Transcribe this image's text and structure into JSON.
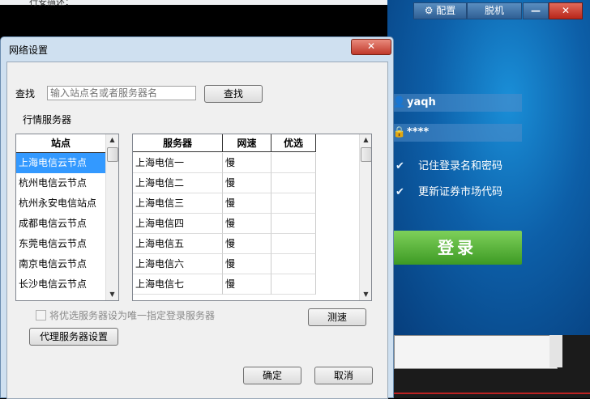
{
  "background": {
    "top_text": "行安描述：",
    "config_label": "配置",
    "offline_label": "脱机",
    "minimize_label": "—",
    "close_label": "✕",
    "username": "yaqh",
    "password_mask": "****",
    "remember_label": "记住登录名和密码",
    "update_label": "更新证券市场代码",
    "login_label": "登录"
  },
  "dialog": {
    "title": "网络设置",
    "close_label": "✕",
    "search": {
      "label": "查找",
      "placeholder": "输入站点名或者服务器名",
      "button": "查找"
    },
    "group_label": "行情服务器",
    "station_header": "站点",
    "stations": [
      "上海电信云节点",
      "杭州电信云节点",
      "杭州永安电信站点",
      "成都电信云节点",
      "东莞电信云节点",
      "南京电信云节点",
      "长沙电信云节点"
    ],
    "selected_station": 0,
    "grid_headers": {
      "server": "服务器",
      "speed": "网速",
      "preferred": "优选"
    },
    "servers": [
      {
        "server": "上海电信一",
        "speed": "慢",
        "preferred": ""
      },
      {
        "server": "上海电信二",
        "speed": "慢",
        "preferred": ""
      },
      {
        "server": "上海电信三",
        "speed": "慢",
        "preferred": ""
      },
      {
        "server": "上海电信四",
        "speed": "慢",
        "preferred": ""
      },
      {
        "server": "上海电信五",
        "speed": "慢",
        "preferred": ""
      },
      {
        "server": "上海电信六",
        "speed": "慢",
        "preferred": ""
      },
      {
        "server": "上海电信七",
        "speed": "慢",
        "preferred": ""
      }
    ],
    "only_preferred_label": "将优选服务器设为唯一指定登录服务器",
    "speed_test_button": "测速",
    "proxy_button": "代理服务器设置",
    "ok_button": "确定",
    "cancel_button": "取消"
  },
  "colors": {
    "selection": "#3399ff",
    "login_green": "#3d9a24",
    "login_bg": "#0d5fa8"
  }
}
